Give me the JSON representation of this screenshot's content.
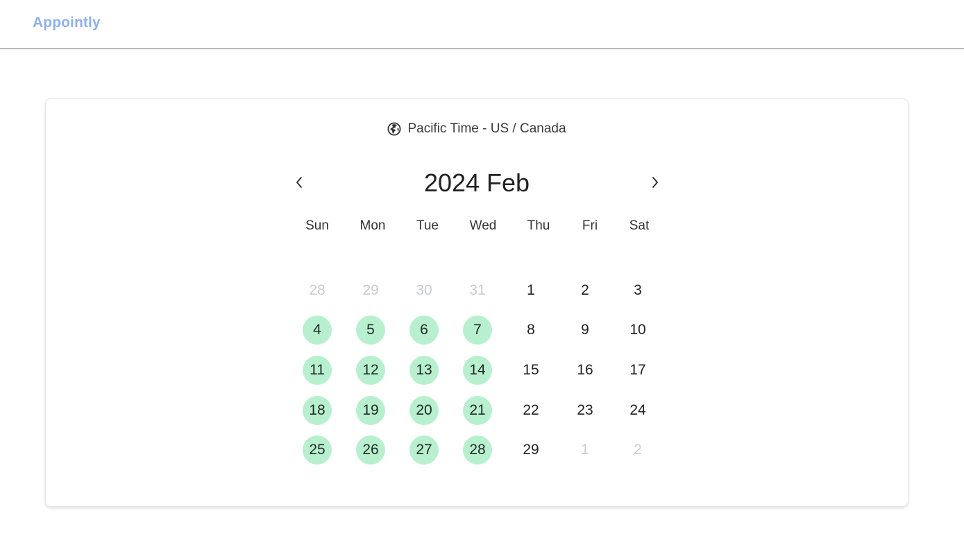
{
  "header": {
    "brand": "Appointly"
  },
  "calendar": {
    "timezone_label": "Pacific Time - US / Canada",
    "timezone_icon": "globe-icon",
    "month_title": "2024 Feb",
    "prev_icon": "chevron-left-icon",
    "next_icon": "chevron-right-icon",
    "weekdays": [
      "Sun",
      "Mon",
      "Tue",
      "Wed",
      "Thu",
      "Fri",
      "Sat"
    ],
    "weeks": [
      [
        {
          "day": "28",
          "state": "outside"
        },
        {
          "day": "29",
          "state": "outside"
        },
        {
          "day": "30",
          "state": "outside"
        },
        {
          "day": "31",
          "state": "outside"
        },
        {
          "day": "1",
          "state": "normal"
        },
        {
          "day": "2",
          "state": "normal"
        },
        {
          "day": "3",
          "state": "normal"
        }
      ],
      [
        {
          "day": "4",
          "state": "available"
        },
        {
          "day": "5",
          "state": "available"
        },
        {
          "day": "6",
          "state": "available"
        },
        {
          "day": "7",
          "state": "available"
        },
        {
          "day": "8",
          "state": "normal"
        },
        {
          "day": "9",
          "state": "normal"
        },
        {
          "day": "10",
          "state": "normal"
        }
      ],
      [
        {
          "day": "11",
          "state": "available"
        },
        {
          "day": "12",
          "state": "available"
        },
        {
          "day": "13",
          "state": "available"
        },
        {
          "day": "14",
          "state": "available"
        },
        {
          "day": "15",
          "state": "normal"
        },
        {
          "day": "16",
          "state": "normal"
        },
        {
          "day": "17",
          "state": "normal"
        }
      ],
      [
        {
          "day": "18",
          "state": "available"
        },
        {
          "day": "19",
          "state": "available"
        },
        {
          "day": "20",
          "state": "available"
        },
        {
          "day": "21",
          "state": "available"
        },
        {
          "day": "22",
          "state": "normal"
        },
        {
          "day": "23",
          "state": "normal"
        },
        {
          "day": "24",
          "state": "normal"
        }
      ],
      [
        {
          "day": "25",
          "state": "available"
        },
        {
          "day": "26",
          "state": "available"
        },
        {
          "day": "27",
          "state": "available"
        },
        {
          "day": "28",
          "state": "available"
        },
        {
          "day": "29",
          "state": "normal"
        },
        {
          "day": "1",
          "state": "outside"
        },
        {
          "day": "2",
          "state": "outside"
        }
      ]
    ]
  },
  "colors": {
    "brand": "#8fb1ec",
    "available_bg": "#b8f0cf",
    "outside_day": "#c9ccd1"
  }
}
